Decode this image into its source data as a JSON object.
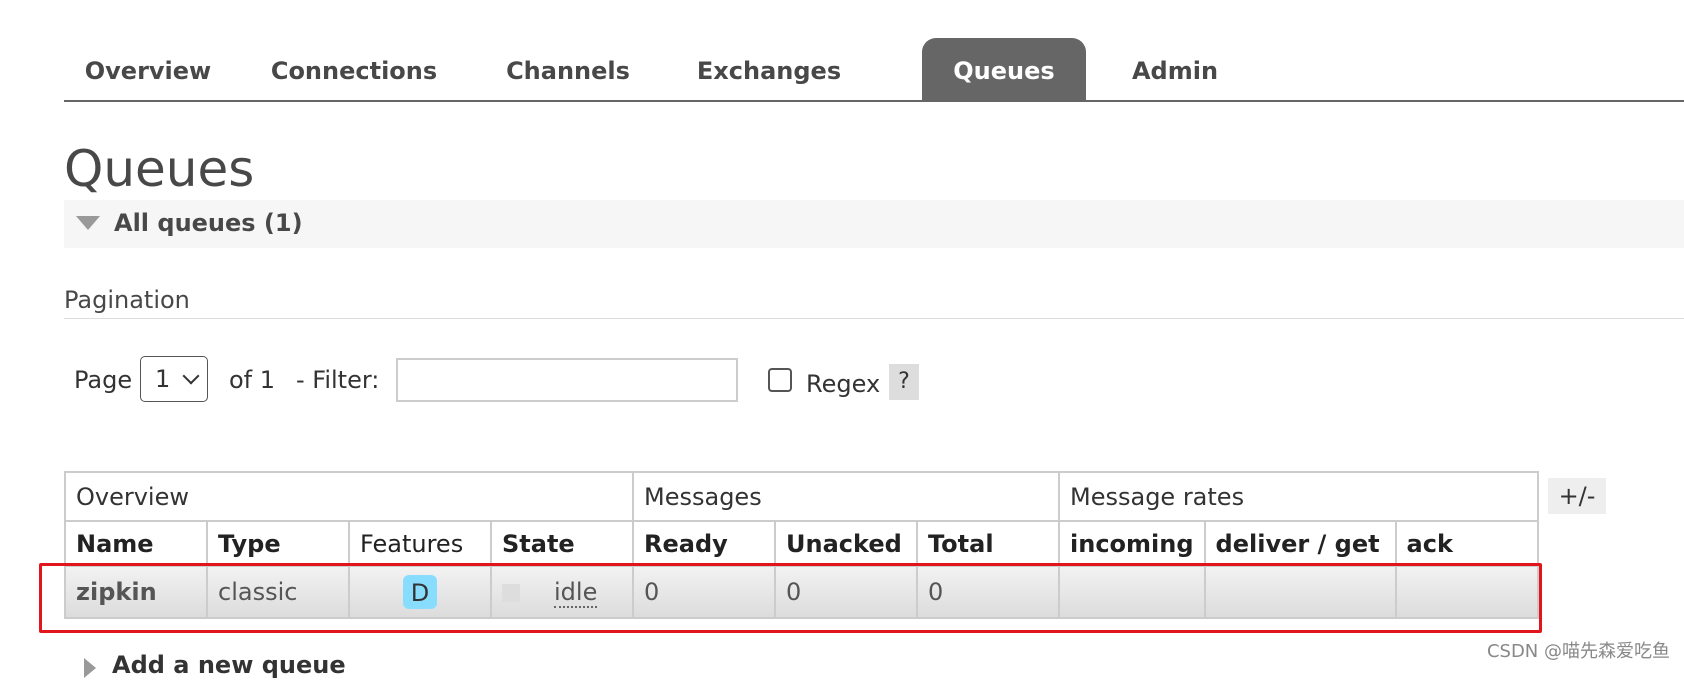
{
  "nav": {
    "tabs": [
      {
        "label": "Overview",
        "active": false
      },
      {
        "label": "Connections",
        "active": false
      },
      {
        "label": "Channels",
        "active": false
      },
      {
        "label": "Exchanges",
        "active": false
      },
      {
        "label": "Queues",
        "active": true
      },
      {
        "label": "Admin",
        "active": false
      }
    ]
  },
  "page": {
    "title": "Queues",
    "section_label": "All queues (1)"
  },
  "pagination": {
    "title": "Pagination",
    "page_label": "Page",
    "page_value": "1",
    "of_label": "of 1",
    "filter_label": "- Filter:",
    "filter_value": "",
    "regex_label": "Regex",
    "regex_checked": false,
    "help_label": "?"
  },
  "table": {
    "toggle_label": "+/-",
    "groups": [
      "Overview",
      "Messages",
      "Message rates"
    ],
    "columns": [
      "Name",
      "Type",
      "Features",
      "State",
      "Ready",
      "Unacked",
      "Total",
      "incoming",
      "deliver / get",
      "ack"
    ],
    "rows": [
      {
        "name": "zipkin",
        "type": "classic",
        "features": "D",
        "state": "idle",
        "ready": "0",
        "unacked": "0",
        "total": "0",
        "incoming": "",
        "deliver_get": "",
        "ack": ""
      }
    ]
  },
  "add_queue": {
    "label": "Add a new queue"
  },
  "watermark": "CSDN @喵先森爱吃鱼",
  "colors": {
    "active_tab": "#666666",
    "highlight_border": "#e0161c",
    "feature_badge": "#88ddff"
  }
}
